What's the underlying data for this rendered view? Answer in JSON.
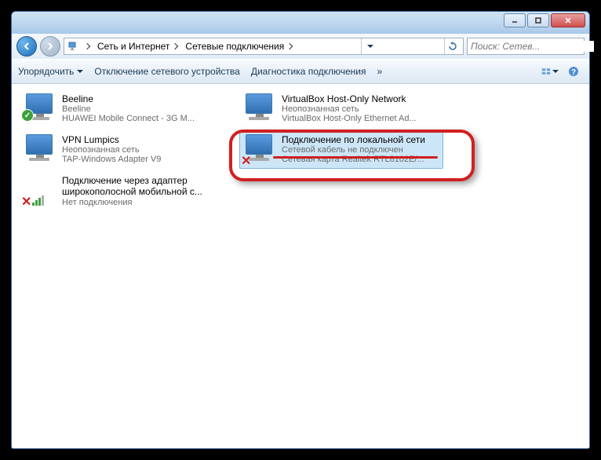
{
  "breadcrumb": {
    "seg1": "Сеть и Интернет",
    "seg2": "Сетевые подключения"
  },
  "search": {
    "placeholder": "Поиск: Сетев..."
  },
  "toolbar": {
    "organize": "Упорядочить",
    "disable": "Отключение сетевого устройства",
    "diagnose": "Диагностика подключения",
    "more": "»"
  },
  "items": [
    {
      "name": "Beeline",
      "status": "Beeline",
      "device": "HUAWEI Mobile Connect - 3G M..."
    },
    {
      "name": "VirtualBox Host-Only Network",
      "status": "Неопознанная сеть",
      "device": "VirtualBox Host-Only Ethernet Ad..."
    },
    {
      "name": "VPN Lumpics",
      "status": "Неопознанная сеть",
      "device": "TAP-Windows Adapter V9"
    },
    {
      "name": "Подключение по локальной сети",
      "status": "Сетевой кабель не подключен",
      "device": "Сетевая карта Realtek RTL8102E/..."
    },
    {
      "name": "Подключение через адаптер широкополосной мобильной с...",
      "status": "Нет подключения",
      "device": ""
    }
  ]
}
